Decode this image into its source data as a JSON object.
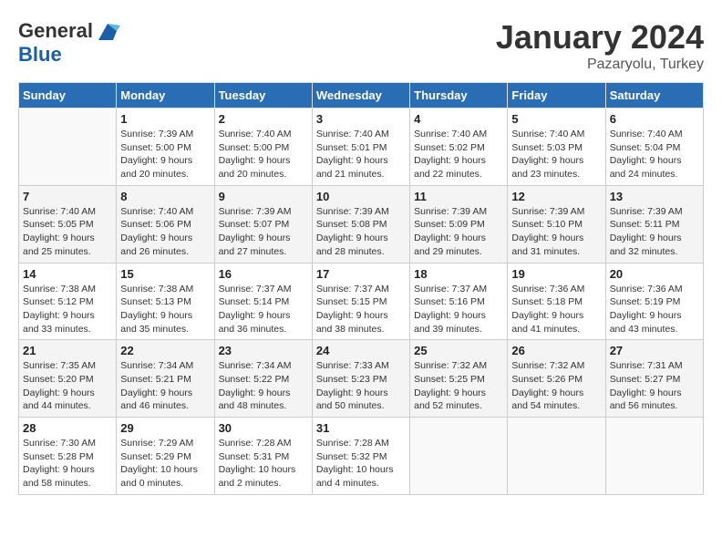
{
  "header": {
    "logo_line1": "General",
    "logo_line2": "Blue",
    "month": "January 2024",
    "location": "Pazaryolu, Turkey"
  },
  "days_of_week": [
    "Sunday",
    "Monday",
    "Tuesday",
    "Wednesday",
    "Thursday",
    "Friday",
    "Saturday"
  ],
  "weeks": [
    [
      {
        "day": "",
        "info": ""
      },
      {
        "day": "1",
        "info": "Sunrise: 7:39 AM\nSunset: 5:00 PM\nDaylight: 9 hours\nand 20 minutes."
      },
      {
        "day": "2",
        "info": "Sunrise: 7:40 AM\nSunset: 5:00 PM\nDaylight: 9 hours\nand 20 minutes."
      },
      {
        "day": "3",
        "info": "Sunrise: 7:40 AM\nSunset: 5:01 PM\nDaylight: 9 hours\nand 21 minutes."
      },
      {
        "day": "4",
        "info": "Sunrise: 7:40 AM\nSunset: 5:02 PM\nDaylight: 9 hours\nand 22 minutes."
      },
      {
        "day": "5",
        "info": "Sunrise: 7:40 AM\nSunset: 5:03 PM\nDaylight: 9 hours\nand 23 minutes."
      },
      {
        "day": "6",
        "info": "Sunrise: 7:40 AM\nSunset: 5:04 PM\nDaylight: 9 hours\nand 24 minutes."
      }
    ],
    [
      {
        "day": "7",
        "info": "Sunrise: 7:40 AM\nSunset: 5:05 PM\nDaylight: 9 hours\nand 25 minutes."
      },
      {
        "day": "8",
        "info": "Sunrise: 7:40 AM\nSunset: 5:06 PM\nDaylight: 9 hours\nand 26 minutes."
      },
      {
        "day": "9",
        "info": "Sunrise: 7:39 AM\nSunset: 5:07 PM\nDaylight: 9 hours\nand 27 minutes."
      },
      {
        "day": "10",
        "info": "Sunrise: 7:39 AM\nSunset: 5:08 PM\nDaylight: 9 hours\nand 28 minutes."
      },
      {
        "day": "11",
        "info": "Sunrise: 7:39 AM\nSunset: 5:09 PM\nDaylight: 9 hours\nand 29 minutes."
      },
      {
        "day": "12",
        "info": "Sunrise: 7:39 AM\nSunset: 5:10 PM\nDaylight: 9 hours\nand 31 minutes."
      },
      {
        "day": "13",
        "info": "Sunrise: 7:39 AM\nSunset: 5:11 PM\nDaylight: 9 hours\nand 32 minutes."
      }
    ],
    [
      {
        "day": "14",
        "info": "Sunrise: 7:38 AM\nSunset: 5:12 PM\nDaylight: 9 hours\nand 33 minutes."
      },
      {
        "day": "15",
        "info": "Sunrise: 7:38 AM\nSunset: 5:13 PM\nDaylight: 9 hours\nand 35 minutes."
      },
      {
        "day": "16",
        "info": "Sunrise: 7:37 AM\nSunset: 5:14 PM\nDaylight: 9 hours\nand 36 minutes."
      },
      {
        "day": "17",
        "info": "Sunrise: 7:37 AM\nSunset: 5:15 PM\nDaylight: 9 hours\nand 38 minutes."
      },
      {
        "day": "18",
        "info": "Sunrise: 7:37 AM\nSunset: 5:16 PM\nDaylight: 9 hours\nand 39 minutes."
      },
      {
        "day": "19",
        "info": "Sunrise: 7:36 AM\nSunset: 5:18 PM\nDaylight: 9 hours\nand 41 minutes."
      },
      {
        "day": "20",
        "info": "Sunrise: 7:36 AM\nSunset: 5:19 PM\nDaylight: 9 hours\nand 43 minutes."
      }
    ],
    [
      {
        "day": "21",
        "info": "Sunrise: 7:35 AM\nSunset: 5:20 PM\nDaylight: 9 hours\nand 44 minutes."
      },
      {
        "day": "22",
        "info": "Sunrise: 7:34 AM\nSunset: 5:21 PM\nDaylight: 9 hours\nand 46 minutes."
      },
      {
        "day": "23",
        "info": "Sunrise: 7:34 AM\nSunset: 5:22 PM\nDaylight: 9 hours\nand 48 minutes."
      },
      {
        "day": "24",
        "info": "Sunrise: 7:33 AM\nSunset: 5:23 PM\nDaylight: 9 hours\nand 50 minutes."
      },
      {
        "day": "25",
        "info": "Sunrise: 7:32 AM\nSunset: 5:25 PM\nDaylight: 9 hours\nand 52 minutes."
      },
      {
        "day": "26",
        "info": "Sunrise: 7:32 AM\nSunset: 5:26 PM\nDaylight: 9 hours\nand 54 minutes."
      },
      {
        "day": "27",
        "info": "Sunrise: 7:31 AM\nSunset: 5:27 PM\nDaylight: 9 hours\nand 56 minutes."
      }
    ],
    [
      {
        "day": "28",
        "info": "Sunrise: 7:30 AM\nSunset: 5:28 PM\nDaylight: 9 hours\nand 58 minutes."
      },
      {
        "day": "29",
        "info": "Sunrise: 7:29 AM\nSunset: 5:29 PM\nDaylight: 10 hours\nand 0 minutes."
      },
      {
        "day": "30",
        "info": "Sunrise: 7:28 AM\nSunset: 5:31 PM\nDaylight: 10 hours\nand 2 minutes."
      },
      {
        "day": "31",
        "info": "Sunrise: 7:28 AM\nSunset: 5:32 PM\nDaylight: 10 hours\nand 4 minutes."
      },
      {
        "day": "",
        "info": ""
      },
      {
        "day": "",
        "info": ""
      },
      {
        "day": "",
        "info": ""
      }
    ]
  ]
}
